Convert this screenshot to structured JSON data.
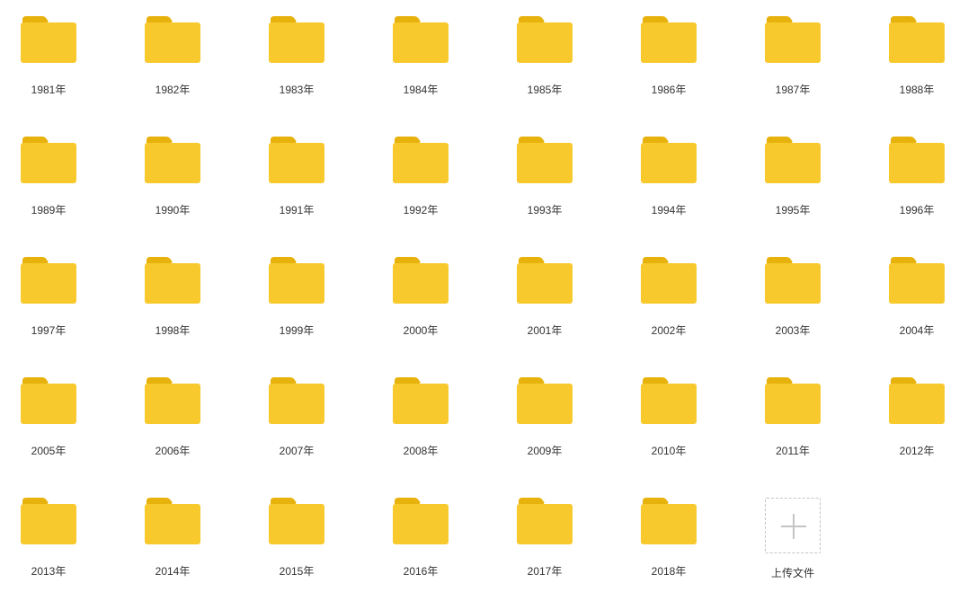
{
  "colors": {
    "folder_body": "#F7C92C",
    "folder_tab": "#E7B20C",
    "label_text": "#333333",
    "upload_border": "#C4C4C4"
  },
  "folders": [
    {
      "label": "1981年",
      "icon": "folder-icon"
    },
    {
      "label": "1982年",
      "icon": "folder-icon"
    },
    {
      "label": "1983年",
      "icon": "folder-icon"
    },
    {
      "label": "1984年",
      "icon": "folder-icon"
    },
    {
      "label": "1985年",
      "icon": "folder-icon"
    },
    {
      "label": "1986年",
      "icon": "folder-icon"
    },
    {
      "label": "1987年",
      "icon": "folder-icon"
    },
    {
      "label": "1988年",
      "icon": "folder-icon"
    },
    {
      "label": "1989年",
      "icon": "folder-icon"
    },
    {
      "label": "1990年",
      "icon": "folder-icon"
    },
    {
      "label": "1991年",
      "icon": "folder-icon"
    },
    {
      "label": "1992年",
      "icon": "folder-icon"
    },
    {
      "label": "1993年",
      "icon": "folder-icon"
    },
    {
      "label": "1994年",
      "icon": "folder-icon"
    },
    {
      "label": "1995年",
      "icon": "folder-icon"
    },
    {
      "label": "1996年",
      "icon": "folder-icon"
    },
    {
      "label": "1997年",
      "icon": "folder-icon"
    },
    {
      "label": "1998年",
      "icon": "folder-icon"
    },
    {
      "label": "1999年",
      "icon": "folder-icon"
    },
    {
      "label": "2000年",
      "icon": "folder-icon"
    },
    {
      "label": "2001年",
      "icon": "folder-icon"
    },
    {
      "label": "2002年",
      "icon": "folder-icon"
    },
    {
      "label": "2003年",
      "icon": "folder-icon"
    },
    {
      "label": "2004年",
      "icon": "folder-icon"
    },
    {
      "label": "2005年",
      "icon": "folder-icon"
    },
    {
      "label": "2006年",
      "icon": "folder-icon"
    },
    {
      "label": "2007年",
      "icon": "folder-icon"
    },
    {
      "label": "2008年",
      "icon": "folder-icon"
    },
    {
      "label": "2009年",
      "icon": "folder-icon"
    },
    {
      "label": "2010年",
      "icon": "folder-icon"
    },
    {
      "label": "2011年",
      "icon": "folder-icon"
    },
    {
      "label": "2012年",
      "icon": "folder-icon"
    },
    {
      "label": "2013年",
      "icon": "folder-icon"
    },
    {
      "label": "2014年",
      "icon": "folder-icon"
    },
    {
      "label": "2015年",
      "icon": "folder-icon"
    },
    {
      "label": "2016年",
      "icon": "folder-icon"
    },
    {
      "label": "2017年",
      "icon": "folder-icon"
    },
    {
      "label": "2018年",
      "icon": "folder-icon"
    }
  ],
  "upload": {
    "label": "上传文件",
    "icon": "plus-icon"
  }
}
